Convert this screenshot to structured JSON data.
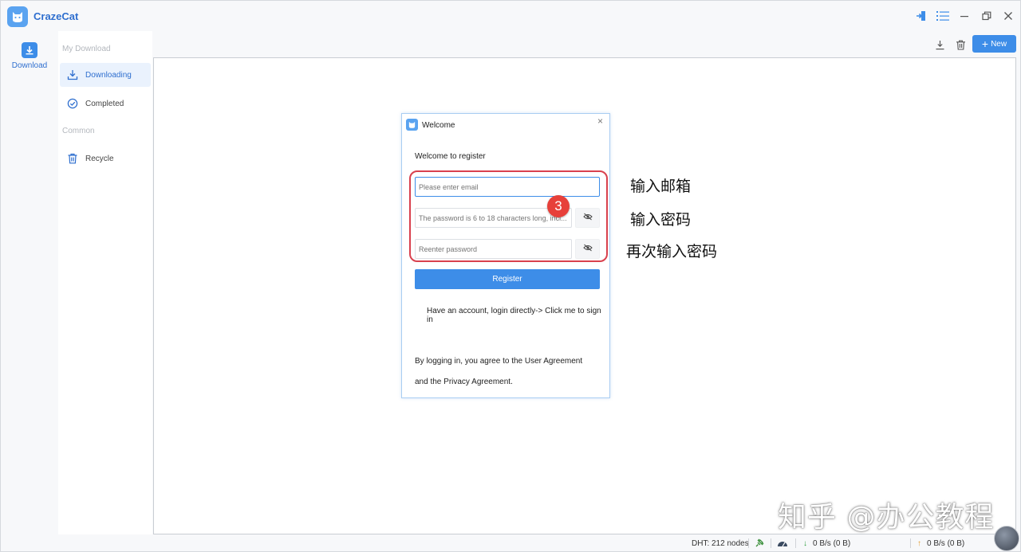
{
  "app": {
    "name": "CrazeCat"
  },
  "rail": {
    "download_label": "Download"
  },
  "sidebar": {
    "section_download": "My Download",
    "section_common": "Common",
    "items": [
      {
        "label": "Downloading",
        "icon": "download-icon",
        "active": true
      },
      {
        "label": "Completed",
        "icon": "check-circle-icon",
        "active": false
      },
      {
        "label": "Recycle",
        "icon": "trash-icon",
        "active": false
      }
    ]
  },
  "toolbar": {
    "new_label": "New"
  },
  "dialog": {
    "title": "Welcome",
    "subtitle": "Welcome to register",
    "email_placeholder": "Please enter email",
    "password_placeholder": "The password is 6 to 18 characters long, incl...",
    "reenter_placeholder": "Reenter password",
    "register_label": "Register",
    "login_prompt": "Have an account, login directly->",
    "login_link": "Click me to sign in",
    "agreement_line1": "By logging in, you agree to the User Agreement",
    "agreement_line2": "and the Privacy Agreement."
  },
  "annotations": {
    "step_number": "3",
    "label_email": "输入邮箱",
    "label_password": "输入密码",
    "label_reenter": "再次输入密码",
    "accent_color": "#d9414e"
  },
  "status": {
    "dht": "DHT: 212 nodes",
    "down_speed": "0 B/s (0 B)",
    "up_speed": "0 B/s (0 B)"
  },
  "watermark": "知乎 @办公教程",
  "colors": {
    "primary": "#3d8de8",
    "brand": "#2f6fcf"
  }
}
